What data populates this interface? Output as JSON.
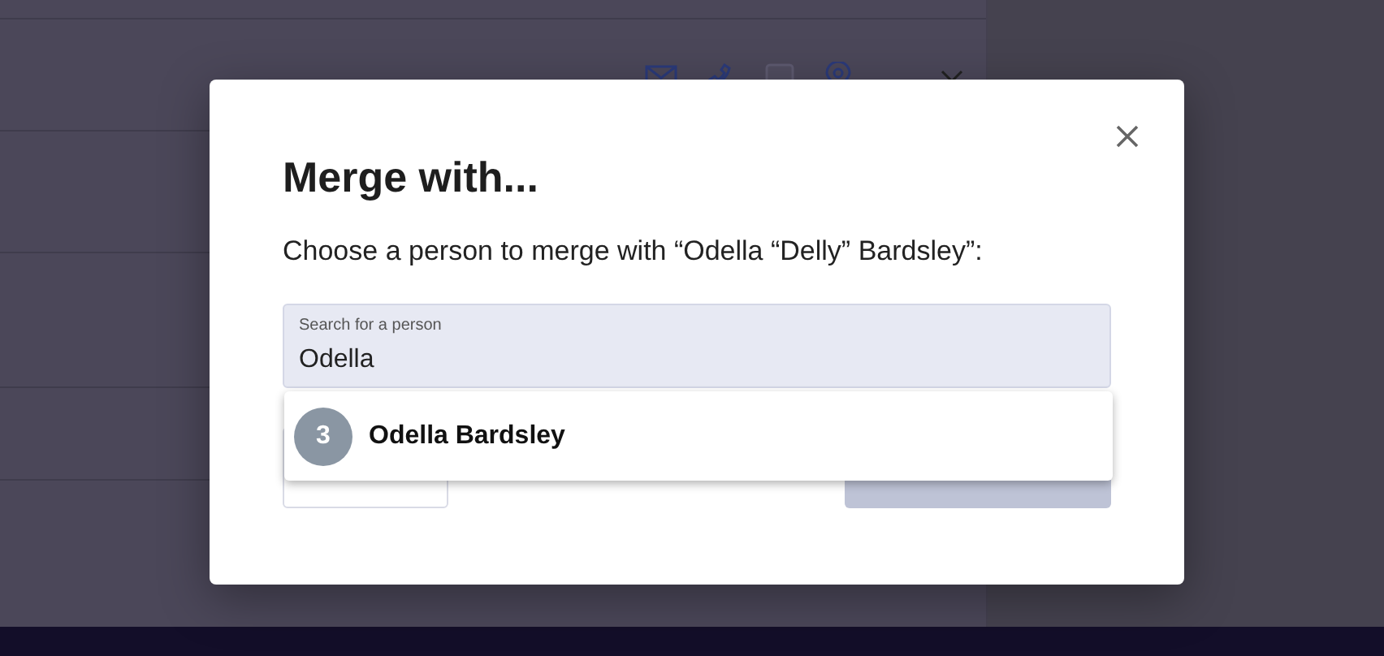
{
  "dialog": {
    "title": "Merge with...",
    "prompt": "Choose a person to merge with “Odella “Delly” Bardsley”:",
    "search": {
      "label": "Search for a person",
      "value": "Odella"
    },
    "results": [
      {
        "badge": "3",
        "name": "Odella Bardsley",
        "selected": false
      }
    ],
    "buttons": [
      {
        "kind": "cancel",
        "disabled": false
      },
      {
        "kind": "primary",
        "disabled": true
      }
    ]
  }
}
